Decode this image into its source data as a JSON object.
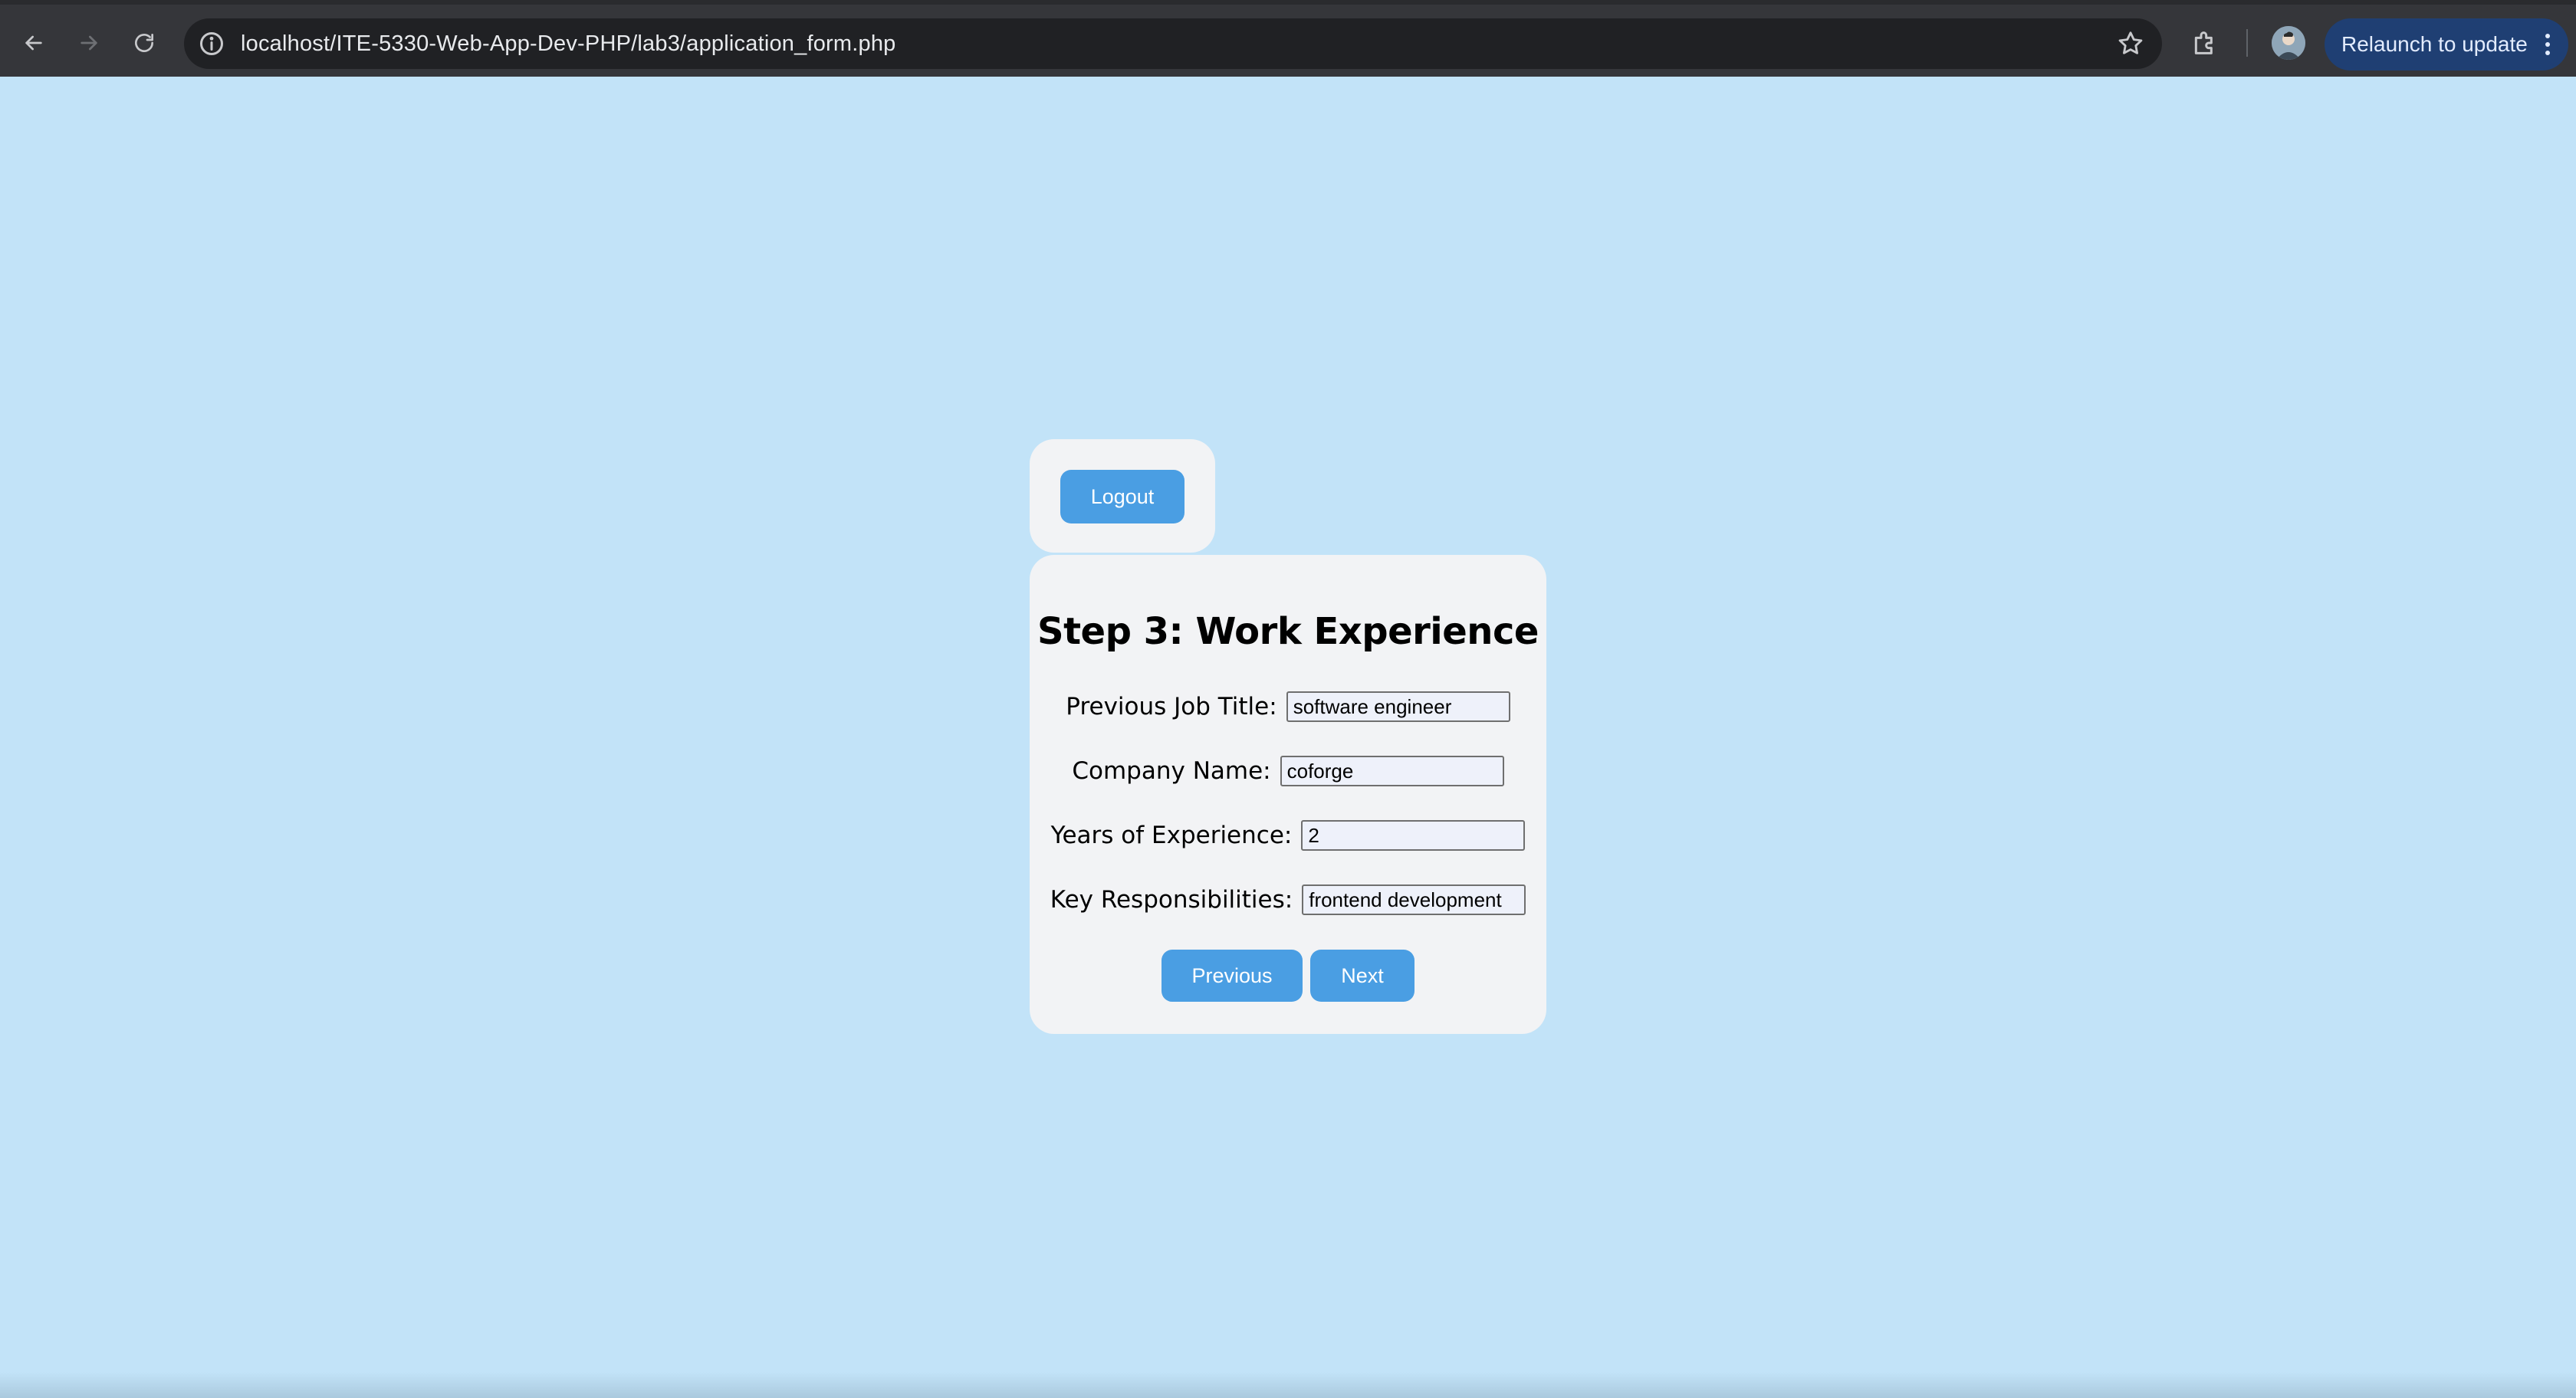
{
  "browser": {
    "url": "localhost/ITE-5330-Web-App-Dev-PHP/lab3/application_form.php",
    "relaunch_label": "Relaunch to update",
    "icons": {
      "back": "arrow-left-icon",
      "forward": "arrow-right-icon",
      "reload": "reload-icon",
      "info": "info-icon",
      "bookmark": "star-icon",
      "extensions": "extensions-icon",
      "menu": "more-vertical-icon"
    }
  },
  "logout": {
    "label": "Logout"
  },
  "form": {
    "title": "Step 3: Work Experience",
    "fields": [
      {
        "label": "Previous Job Title:",
        "value": "software engineer"
      },
      {
        "label": "Company Name:",
        "value": "coforge"
      },
      {
        "label": "Years of Experience:",
        "value": "2"
      },
      {
        "label": "Key Responsibilities:",
        "value": "frontend development"
      }
    ],
    "previous_label": "Previous",
    "next_label": "Next"
  },
  "colors": {
    "page_background": "#c2e3f8",
    "card_background": "#f2f3f5",
    "button": "#4a9ee3",
    "chrome": "#35363a",
    "relaunch": "#1f3f73"
  }
}
